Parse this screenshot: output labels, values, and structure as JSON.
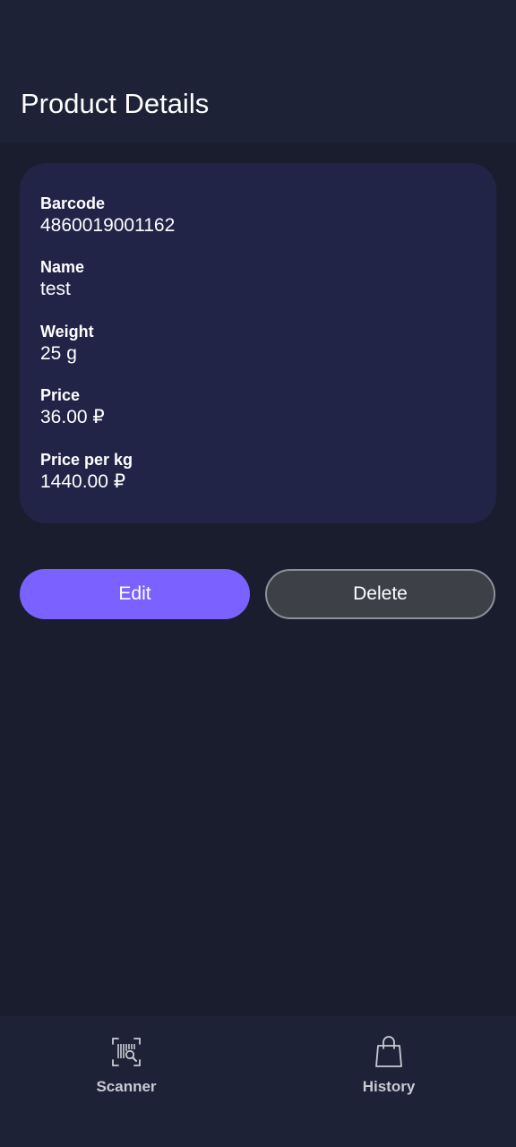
{
  "header": {
    "title": "Product Details"
  },
  "product": {
    "fields": [
      {
        "label": "Barcode",
        "value": "4860019001162"
      },
      {
        "label": "Name",
        "value": "test"
      },
      {
        "label": "Weight",
        "value": "25 g"
      },
      {
        "label": "Price",
        "value": "36.00 ₽"
      },
      {
        "label": "Price per kg",
        "value": "1440.00 ₽"
      }
    ]
  },
  "actions": {
    "edit_label": "Edit",
    "delete_label": "Delete"
  },
  "bottom_nav": {
    "items": [
      {
        "label": "Scanner",
        "icon": "barcode-scan-icon"
      },
      {
        "label": "History",
        "icon": "shopping-bag-icon"
      }
    ]
  },
  "colors": {
    "background": "#1a1d2e",
    "surface": "#1e2236",
    "card": "#212447",
    "accent": "#7b61ff",
    "secondary_button": "#3e4048"
  }
}
